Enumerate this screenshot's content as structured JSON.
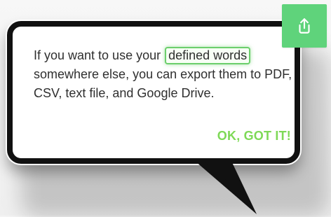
{
  "tooltip": {
    "text_before": "If you want to use your ",
    "highlight": "defined words",
    "text_after": " somewhere else, you can export them to PDF, CSV, text file, and Google Drive.",
    "ok_label": "OK, GOT IT!"
  },
  "icons": {
    "export": "share-upload-icon"
  },
  "colors": {
    "accent": "#7ed957",
    "button_bg": "#5fd37b",
    "highlight_border": "#6ccf6c",
    "tooltip_border": "#111111"
  }
}
